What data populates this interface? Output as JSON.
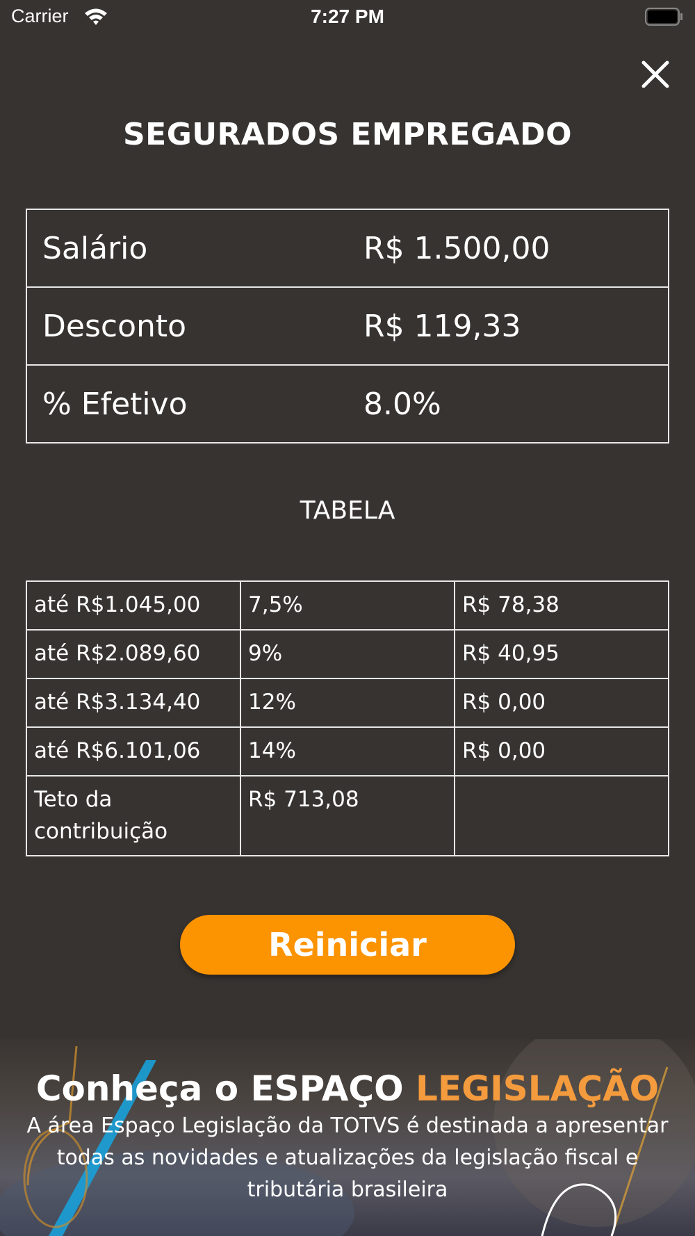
{
  "status_bar": {
    "carrier": "Carrier",
    "time": "7:27 PM"
  },
  "page": {
    "title": "SEGURADOS EMPREGADO"
  },
  "summary": [
    {
      "label": "Salário",
      "value": "R$ 1.500,00"
    },
    {
      "label": "Desconto",
      "value": "R$ 119,33"
    },
    {
      "label": "% Efetivo",
      "value": "8.0%"
    }
  ],
  "table_section": {
    "title": "TABELA",
    "rows": [
      {
        "range": "até R$1.045,00",
        "rate": "7,5%",
        "amount": "R$ 78,38"
      },
      {
        "range": "até R$2.089,60",
        "rate": "9%",
        "amount": "R$ 40,95"
      },
      {
        "range": "até R$3.134,40",
        "rate": "12%",
        "amount": "R$ 0,00"
      },
      {
        "range": "até R$6.101,06",
        "rate": "14%",
        "amount": "R$ 0,00"
      }
    ],
    "ceiling": {
      "label": "Teto da contribuição",
      "value": "R$ 713,08",
      "extra": ""
    }
  },
  "actions": {
    "reset_label": "Reiniciar"
  },
  "promo": {
    "title_prefix": "Conheça o ESPAÇO",
    "title_accent": "LEGISLAÇÃO",
    "text": "A área Espaço Legislação da TOTVS é destinada a apresentar todas as novidades e atualizações da legislação fiscal e tributária brasileira"
  },
  "colors": {
    "background": "#373331",
    "accent": "#fc9301",
    "promo_accent": "#f49b3e"
  },
  "icons": [
    "wifi-icon",
    "battery-icon",
    "close-icon"
  ]
}
